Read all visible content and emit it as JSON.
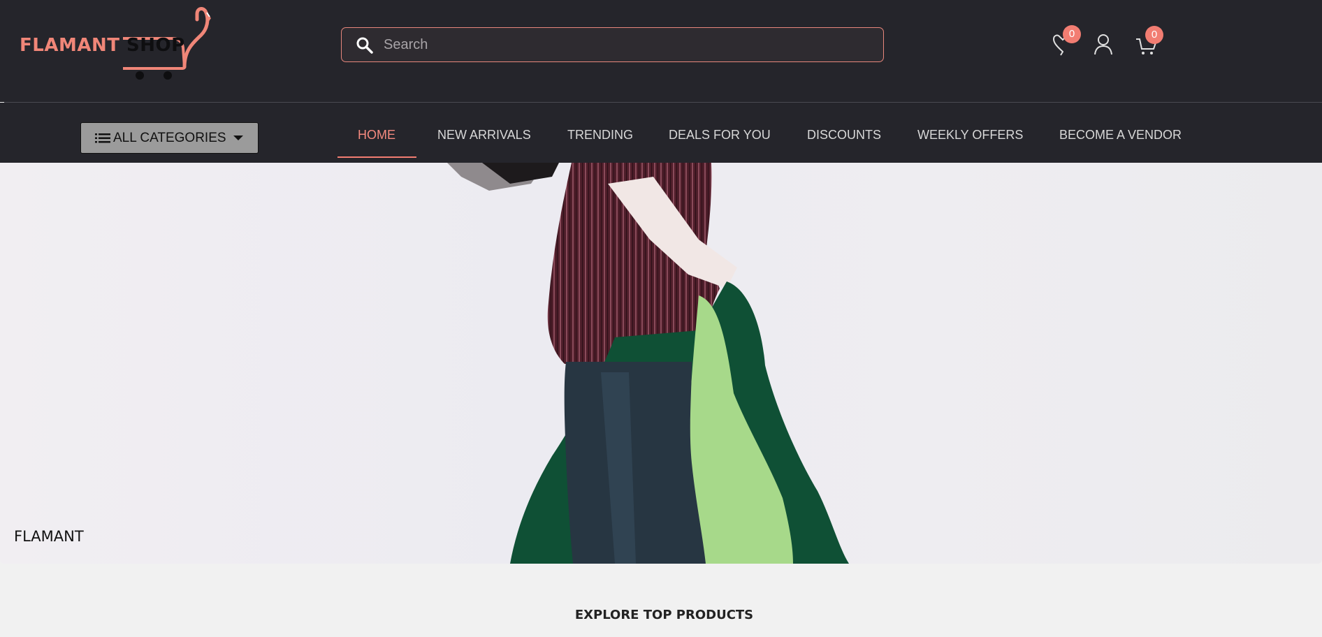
{
  "brand": {
    "name_part1": "FLAMANT",
    "name_part2": "SHOP",
    "logo_icon": "flamingo-cart-icon"
  },
  "search": {
    "placeholder": "Search",
    "value": "",
    "icon": "search-icon"
  },
  "header_icons": {
    "wishlist": {
      "icon": "heart-icon",
      "count": "0"
    },
    "account": {
      "icon": "user-icon"
    },
    "cart": {
      "icon": "cart-icon",
      "count": "0"
    }
  },
  "categories": {
    "label": "ALL CATEGORIES",
    "icon": "list-icon"
  },
  "nav": {
    "items": [
      {
        "label": "HOME",
        "active": true
      },
      {
        "label": "NEW ARRIVALS"
      },
      {
        "label": "TRENDING"
      },
      {
        "label": "DEALS FOR YOU"
      },
      {
        "label": "DISCOUNTS"
      },
      {
        "label": "WEEKLY OFFERS"
      },
      {
        "label": "BECOME A VENDOR"
      }
    ]
  },
  "hero": {
    "caption": "FLAMANT"
  },
  "section": {
    "title": "EXPLORE TOP PRODUCTS"
  },
  "colors": {
    "header_bg": "#25252b",
    "accent": "#f27d72",
    "page_bg": "#f1f1f1"
  }
}
